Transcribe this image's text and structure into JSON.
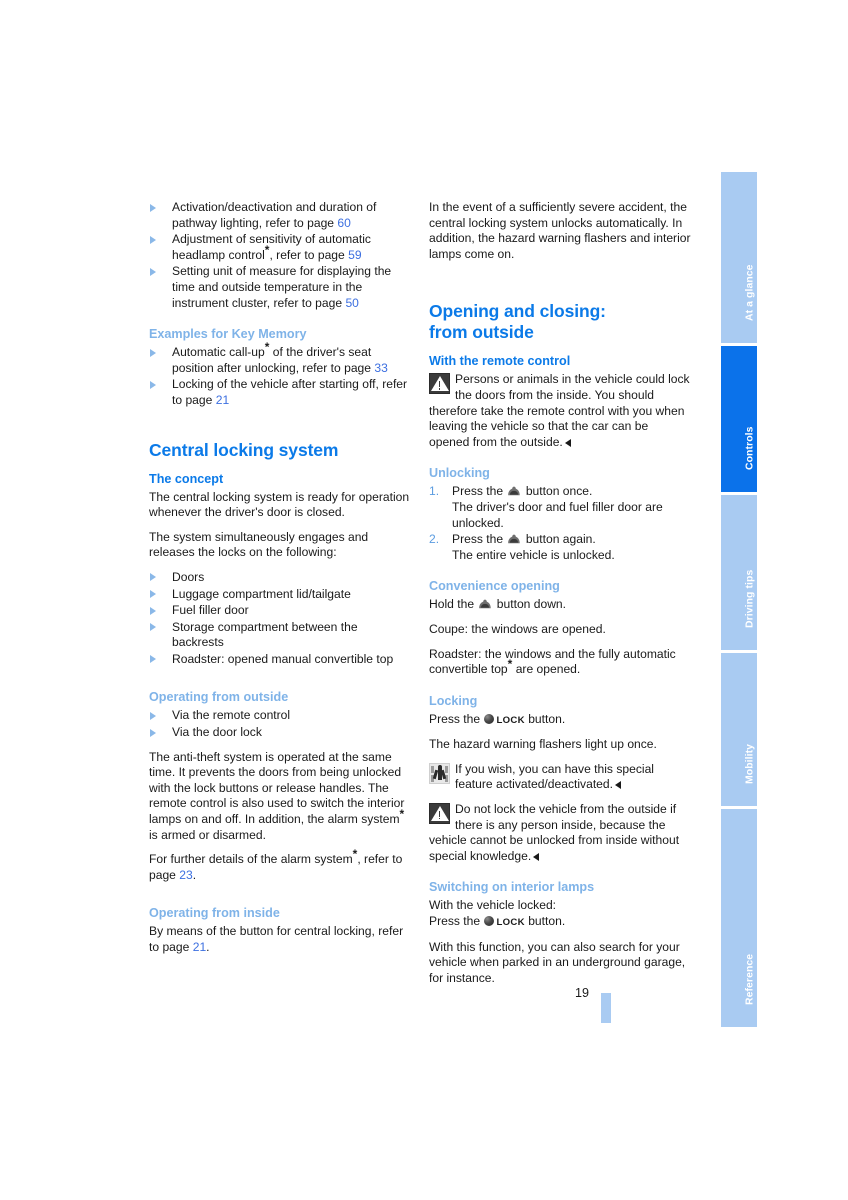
{
  "document": {
    "page_number": "19",
    "accent_primary": "#0b7ae8",
    "accent_secondary": "#7fb3e8",
    "page_ref_color": "#3c6fe0",
    "tab_active_color": "#0b72ea",
    "tab_inactive_color": "#a9cbf2"
  },
  "tabs": [
    {
      "label": "At a glance",
      "active": false
    },
    {
      "label": "Controls",
      "active": true
    },
    {
      "label": "Driving tips",
      "active": false
    },
    {
      "label": "Mobility",
      "active": false
    },
    {
      "label": "Reference",
      "active": false
    }
  ],
  "left_column": {
    "top_bullets": [
      {
        "text_a": "Activation/deactivation and duration of pathway lighting, refer to page ",
        "page": "60",
        "text_b": ""
      },
      {
        "text_a": "Adjustment of sensitivity of automatic headlamp control",
        "asterisk": "*",
        "text_mid": ", refer to page ",
        "page": "59",
        "text_b": ""
      },
      {
        "text_a": "Setting unit of measure for displaying the time and outside temperature in the instrument cluster, refer to page ",
        "page": "50",
        "text_b": ""
      }
    ],
    "key_memory": {
      "heading": "Examples for Key Memory",
      "bullets": [
        {
          "text_a": "Automatic call-up",
          "asterisk": "*",
          "text_mid": " of the driver's seat position after unlocking, refer to page ",
          "page": "33",
          "text_b": ""
        },
        {
          "text_a": "Locking of the vehicle after starting off, refer to page ",
          "page": "21",
          "text_b": ""
        }
      ]
    },
    "central_locking": {
      "heading": "Central locking system",
      "concept": {
        "heading": "The concept",
        "para1": "The central locking system is ready for operation whenever the driver's door is closed.",
        "para2": "The system simultaneously engages and releases the locks on the following:",
        "bullets": [
          "Doors",
          "Luggage compartment lid/tailgate",
          "Fuel filler door",
          "Storage compartment between the backrests",
          "Roadster: opened manual convertible top"
        ]
      },
      "from_outside": {
        "heading": "Operating from outside",
        "bullets": [
          "Via the remote control",
          "Via the door lock"
        ],
        "para1_a": "The anti-theft system is operated at the same time. It prevents the doors from being unlocked with the lock buttons or release handles. The remote control is also used to switch the interior lamps on and off. In addition, the alarm system",
        "para1_asterisk": "*",
        "para1_b": " is armed or disarmed.",
        "para2_a": "For further details of the alarm system",
        "para2_asterisk": "*",
        "para2_mid": ", refer to page ",
        "para2_page": "23",
        "para2_b": "."
      },
      "from_inside": {
        "heading": "Operating from inside",
        "para_a": "By means of the button for central locking, refer to page ",
        "para_page": "21",
        "para_b": "."
      }
    }
  },
  "right_column": {
    "intro_para": "In the event of a sufficiently severe accident, the central locking system unlocks automatically. In addition, the hazard warning flashers and interior lamps come on.",
    "opening_closing": {
      "heading_line1": "Opening and closing:",
      "heading_line2": "from outside"
    },
    "remote_control": {
      "heading": "With the remote control",
      "warning_icon": "warning-triangle-icon",
      "warning_text": "Persons or animals in the vehicle could lock the doors from the inside. You should therefore take the remote control with you when leaving the vehicle so that the car can be opened from the outside."
    },
    "unlocking": {
      "heading": "Unlocking",
      "steps": [
        {
          "number": "1.",
          "text_a": "Press the ",
          "icon": "unlock-button-icon",
          "text_b": " button once.",
          "sub": "The driver's door and fuel filler door are unlocked."
        },
        {
          "number": "2.",
          "text_a": "Press the ",
          "icon": "unlock-button-icon",
          "text_b": " button again.",
          "sub": "The entire vehicle is unlocked."
        }
      ]
    },
    "convenience_opening": {
      "heading": "Convenience opening",
      "line1_a": "Hold the ",
      "line1_icon": "unlock-button-icon",
      "line1_b": " button down.",
      "line2": "Coupe: the windows are opened.",
      "line3_a": "Roadster: the windows and the fully automatic convertible top",
      "line3_asterisk": "*",
      "line3_b": " are opened."
    },
    "locking": {
      "heading": "Locking",
      "line1_a": "Press the ",
      "line1_icon": "lock-button-icon",
      "line1_lock_word": "LOCK",
      "line1_b": " button.",
      "line2": "The hazard warning flashers light up once.",
      "service_icon": "service-person-icon",
      "service_text": "If you wish, you can have this special feature activated/deactivated.",
      "warning_icon": "warning-triangle-icon",
      "warning_text": "Do not lock the vehicle from the outside if there is any person inside, because the vehicle cannot be unlocked from inside without special knowledge."
    },
    "interior_lamps": {
      "heading": "Switching on interior lamps",
      "line1": "With the vehicle locked:",
      "line2_a": "Press the ",
      "line2_icon": "lock-button-icon",
      "line2_lock_word": "LOCK",
      "line2_b": " button.",
      "para": "With this function, you can also search for your vehicle when parked in an underground garage, for instance."
    }
  }
}
